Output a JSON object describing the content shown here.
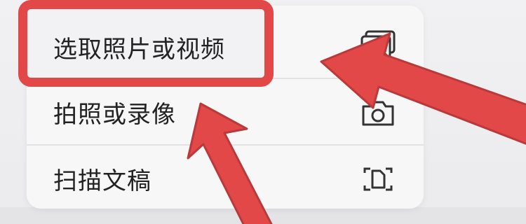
{
  "menu": {
    "items": [
      {
        "label": "选取照片或视频",
        "icon": "photo-icon"
      },
      {
        "label": "拍照或录像",
        "icon": "camera-icon"
      },
      {
        "label": "扫描文稿",
        "icon": "scan-document-icon"
      }
    ]
  },
  "annotation": {
    "highlight_color": "#e24848",
    "arrow_color": "#e24848"
  }
}
